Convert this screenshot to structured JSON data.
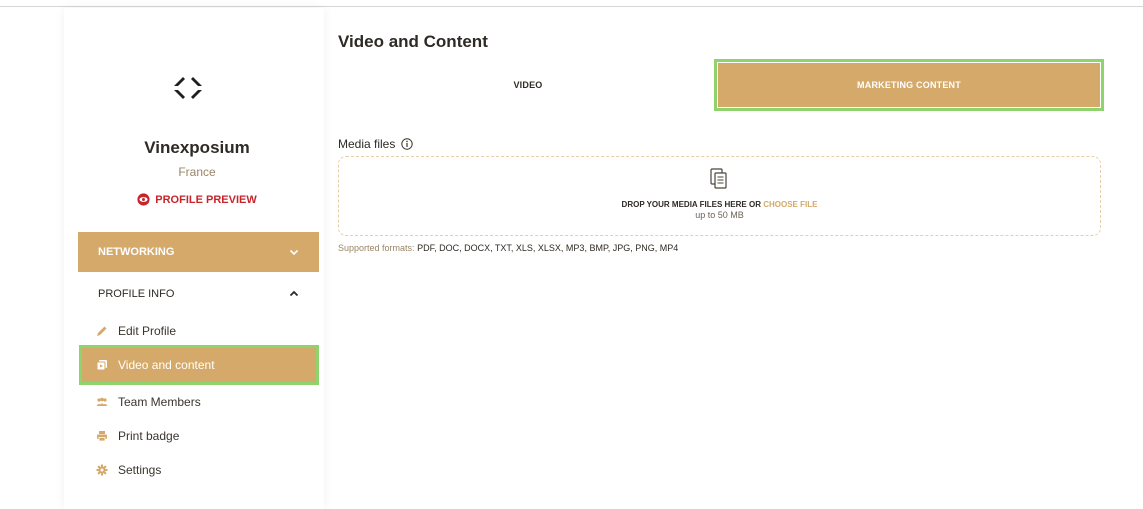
{
  "sidebar": {
    "org_name": "Vinexposium",
    "org_country": "France",
    "profile_preview_label": "PROFILE PREVIEW",
    "networking_label": "NETWORKING",
    "profile_info_label": "PROFILE INFO",
    "items": [
      {
        "label": "Edit Profile",
        "icon": "pencil-icon"
      },
      {
        "label": "Video and content",
        "icon": "media-icon",
        "active": true
      },
      {
        "label": "Team Members",
        "icon": "team-icon"
      },
      {
        "label": "Print badge",
        "icon": "printer-icon"
      },
      {
        "label": "Settings",
        "icon": "gear-icon"
      }
    ]
  },
  "main": {
    "title": "Video and Content",
    "tabs": [
      {
        "label": "VIDEO",
        "active": false
      },
      {
        "label": "MARKETING CONTENT",
        "active": true
      }
    ],
    "media_files_label": "Media files",
    "dropzone": {
      "prompt": "DROP YOUR MEDIA FILES HERE OR ",
      "choose_label": "CHOOSE FILE",
      "size_limit": "up to 50 MB"
    },
    "supported_formats_label": "Supported formats:",
    "supported_formats": "PDF, DOC, DOCX, TXT, XLS, XLSX, MP3, BMP, JPG, PNG, MP4"
  },
  "colors": {
    "accent": "#d4a96a",
    "highlight": "#8ed36b",
    "preview_red": "#c6252c"
  }
}
